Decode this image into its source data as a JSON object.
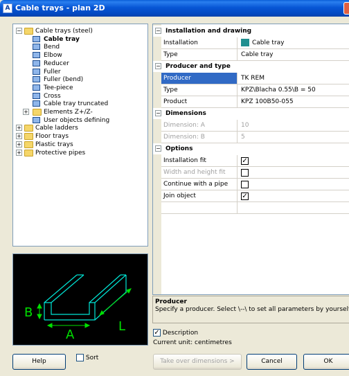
{
  "window": {
    "title": "Cable trays - plan 2D",
    "app_icon": "app-icon"
  },
  "tree": {
    "items": [
      {
        "label": "Cable trays (steel)",
        "level": 0,
        "type": "folder",
        "expander": "minus"
      },
      {
        "label": "Cable tray",
        "level": 1,
        "type": "item",
        "selected": true
      },
      {
        "label": "Bend",
        "level": 1,
        "type": "item"
      },
      {
        "label": "Elbow",
        "level": 1,
        "type": "item"
      },
      {
        "label": "Reducer",
        "level": 1,
        "type": "item"
      },
      {
        "label": "Fuller",
        "level": 1,
        "type": "item"
      },
      {
        "label": "Fuller (bend)",
        "level": 1,
        "type": "item"
      },
      {
        "label": "Tee-piece",
        "level": 1,
        "type": "item"
      },
      {
        "label": "Cross",
        "level": 1,
        "type": "item"
      },
      {
        "label": "Cable tray truncated",
        "level": 1,
        "type": "item"
      },
      {
        "label": "Elements Z+/Z-",
        "level": 1,
        "type": "folder",
        "expander": "plus"
      },
      {
        "label": "User objects defining",
        "level": 1,
        "type": "item"
      },
      {
        "label": "Cable ladders",
        "level": 0,
        "type": "folder",
        "expander": "plus"
      },
      {
        "label": "Floor trays",
        "level": 0,
        "type": "folder",
        "expander": "plus"
      },
      {
        "label": "Plastic trays",
        "level": 0,
        "type": "folder",
        "expander": "plus"
      },
      {
        "label": "Protective pipes",
        "level": 0,
        "type": "folder",
        "expander": "plus"
      }
    ]
  },
  "preview": {
    "label_a": "A",
    "label_b": "B",
    "label_l": "L"
  },
  "properties": {
    "groups": [
      {
        "title": "Installation and drawing",
        "rows": [
          {
            "key": "Installation",
            "value": "Cable tray",
            "swatch": "#1f8f8f"
          },
          {
            "key": "Type",
            "value": "Cable tray"
          }
        ]
      },
      {
        "title": "Producer and type",
        "rows": [
          {
            "key": "Producer",
            "value": "TK REM",
            "highlight": true
          },
          {
            "key": "Type",
            "value": "KPZ\\Blacha 0.55\\B = 50"
          },
          {
            "key": "Product",
            "value": "KPZ 100B50-055"
          }
        ]
      },
      {
        "title": "Dimensions",
        "rows": [
          {
            "key": "Dimension: A",
            "value": "10",
            "disabled": true
          },
          {
            "key": "Dimension: B",
            "value": "5",
            "disabled": true
          }
        ]
      },
      {
        "title": "Options",
        "rows": [
          {
            "key": "Installation fit",
            "checked": true
          },
          {
            "key": "Width and height fit",
            "checked": false,
            "disabled": true
          },
          {
            "key": "Continue with a pipe",
            "checked": false
          },
          {
            "key": "Join object",
            "checked": true
          }
        ]
      }
    ]
  },
  "description": {
    "title": "Producer",
    "text": "Specify a producer. Select \\--\\ to set all parameters by yourself."
  },
  "description_checkbox": {
    "label": "Description",
    "checked": true
  },
  "current_unit": "Current unit: centimetres",
  "sort": {
    "label": "Sort",
    "checked": false
  },
  "buttons": {
    "help": "Help",
    "take_over": "Take over dimensions >",
    "cancel": "Cancel",
    "ok": "OK"
  }
}
